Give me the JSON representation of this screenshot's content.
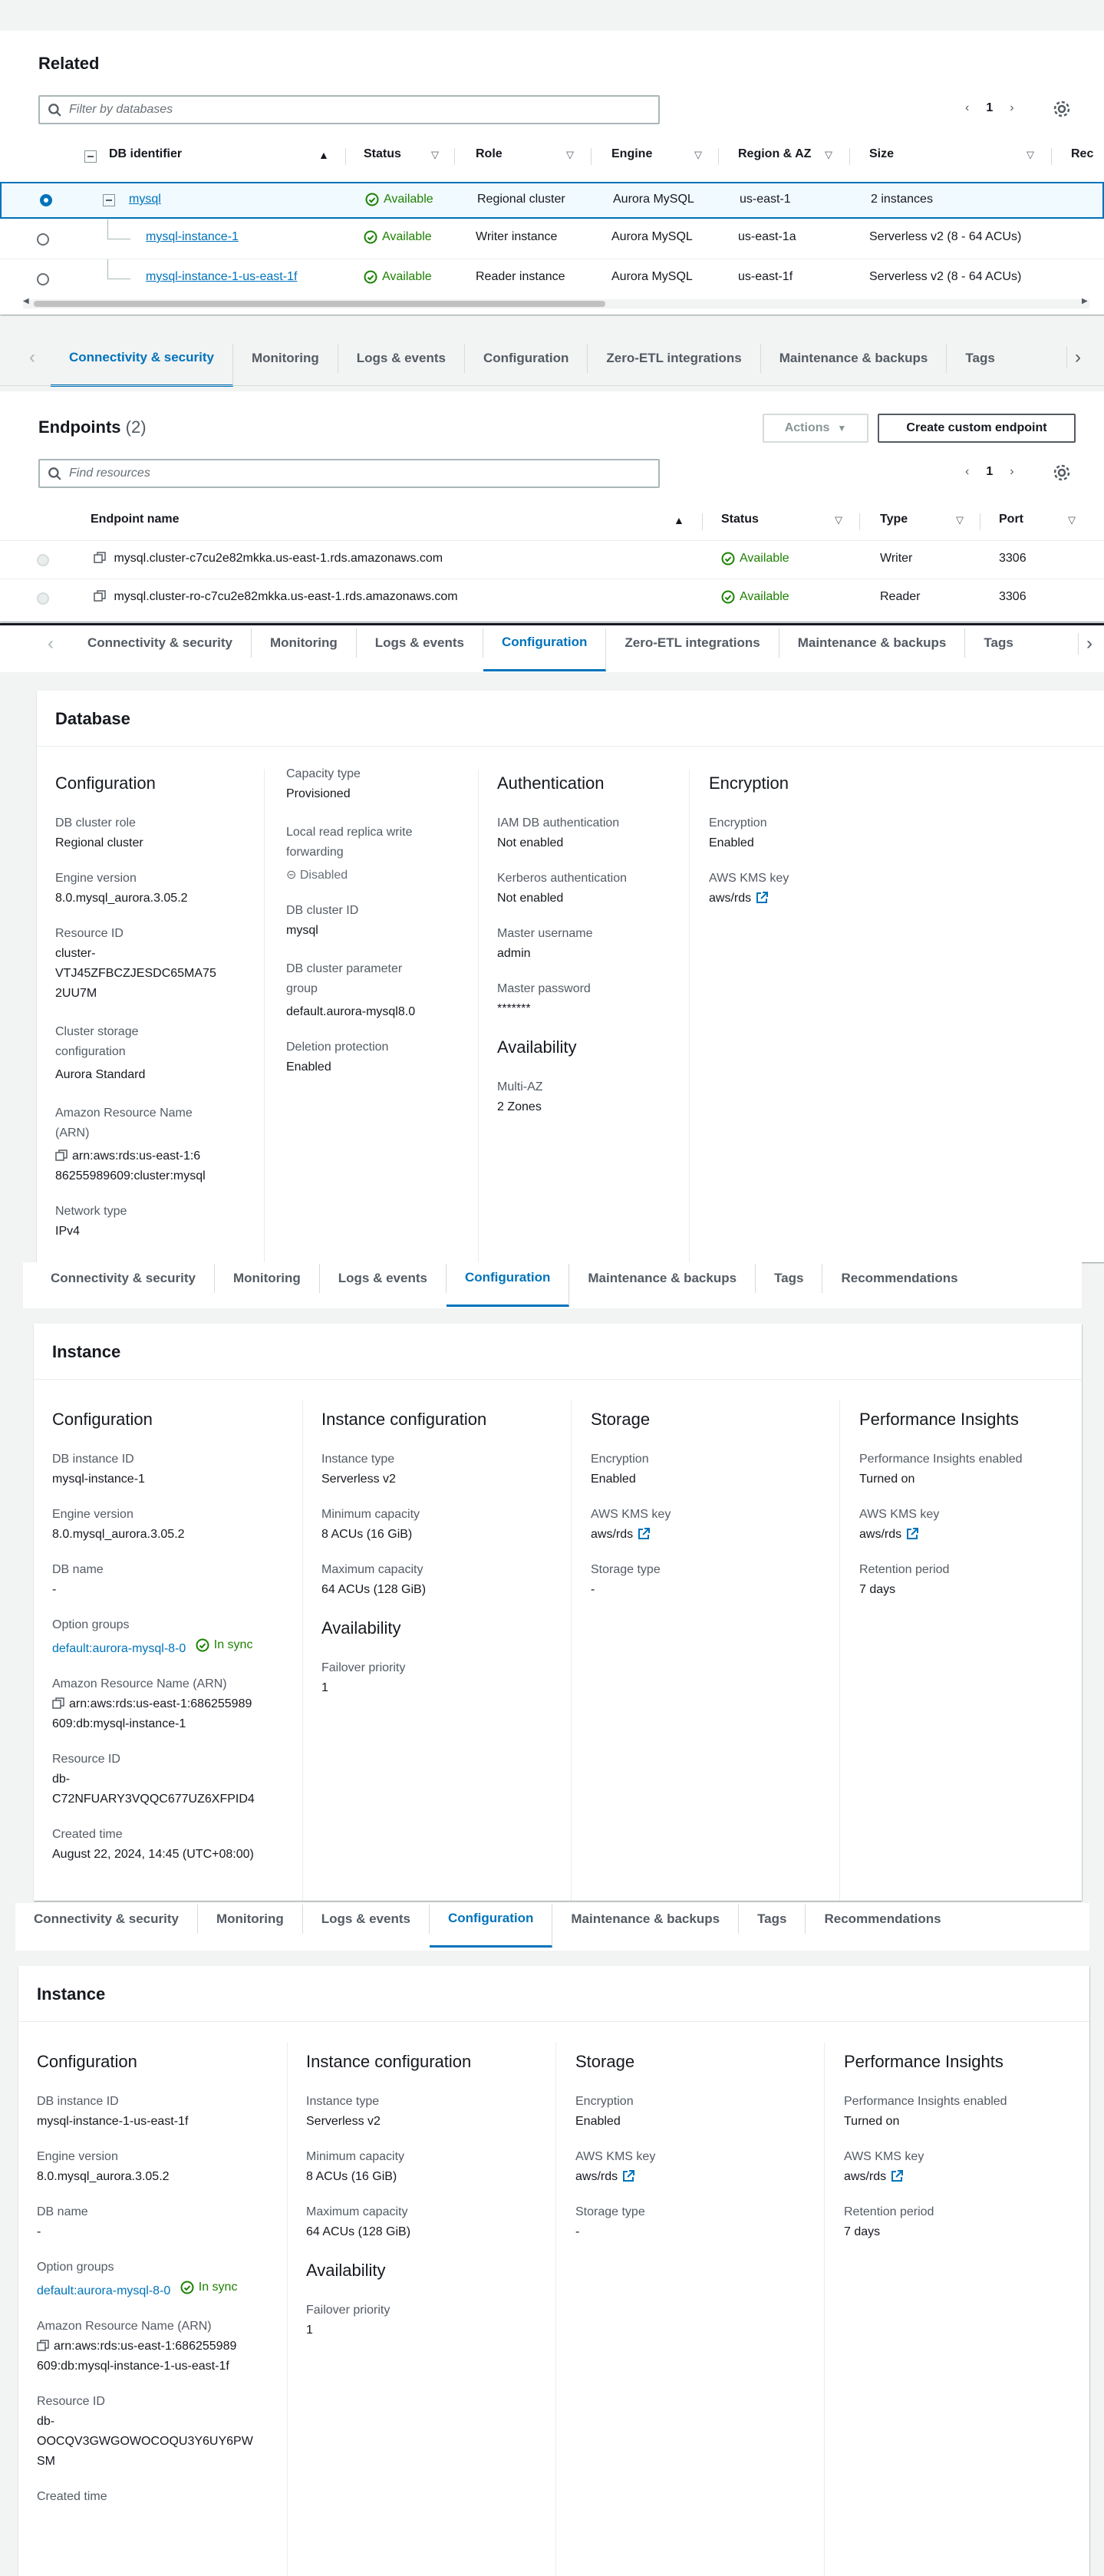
{
  "related": {
    "title": "Related",
    "filter_placeholder": "Filter by databases",
    "page": "1",
    "columns": [
      "DB identifier",
      "Status",
      "Role",
      "Engine",
      "Region & AZ",
      "Size",
      "Rec"
    ],
    "rows": [
      {
        "id": "mysql",
        "status": "Available",
        "role": "Regional cluster",
        "engine": "Aurora MySQL",
        "region": "us-east-1",
        "size": "2 instances"
      },
      {
        "id": "mysql-instance-1",
        "status": "Available",
        "role": "Writer instance",
        "engine": "Aurora MySQL",
        "region": "us-east-1a",
        "size": "Serverless v2 (8 - 64 ACUs)"
      },
      {
        "id": "mysql-instance-1-us-east-1f",
        "status": "Available",
        "role": "Reader instance",
        "engine": "Aurora MySQL",
        "region": "us-east-1f",
        "size": "Serverless v2 (8 - 64 ACUs)"
      }
    ]
  },
  "tabs1": [
    "Connectivity & security",
    "Monitoring",
    "Logs & events",
    "Configuration",
    "Zero-ETL integrations",
    "Maintenance & backups",
    "Tags"
  ],
  "endpoints": {
    "title": "Endpoints",
    "count": "(2)",
    "actions_label": "Actions",
    "create_label": "Create custom endpoint",
    "find_placeholder": "Find resources",
    "page": "1",
    "columns": [
      "Endpoint name",
      "Status",
      "Type",
      "Port"
    ],
    "rows": [
      {
        "name": "mysql.cluster-c7cu2e82mkka.us-east-1.rds.amazonaws.com",
        "status": "Available",
        "type": "Writer",
        "port": "3306"
      },
      {
        "name": "mysql.cluster-ro-c7cu2e82mkka.us-east-1.rds.amazonaws.com",
        "status": "Available",
        "type": "Reader",
        "port": "3306"
      }
    ]
  },
  "tabs2": [
    "Connectivity & security",
    "Monitoring",
    "Logs & events",
    "Configuration",
    "Zero-ETL integrations",
    "Maintenance & backups",
    "Tags"
  ],
  "database": {
    "title": "Database",
    "configuration_heading": "Configuration",
    "cluster_role_label": "DB cluster role",
    "cluster_role": "Regional cluster",
    "engine_version_label": "Engine version",
    "engine_version": "8.0.mysql_aurora.3.05.2",
    "resource_id_label": "Resource ID",
    "resource_id_1": "cluster-",
    "resource_id_2": "VTJ45ZFBCZJESDC65MA75",
    "resource_id_3": "2UU7M",
    "storage_config_label_1": "Cluster storage",
    "storage_config_label_2": "configuration",
    "storage_config": "Aurora Standard",
    "arn_label_1": "Amazon Resource Name",
    "arn_label_2": "(ARN)",
    "arn_1": "arn:aws:rds:us-east-1:6",
    "arn_2": "86255989609:cluster:mysql",
    "network_type_label": "Network type",
    "network_type": "IPv4",
    "capacity_type_label": "Capacity type",
    "capacity_type": "Provisioned",
    "local_read_label_1": "Local read replica write",
    "local_read_label_2": "forwarding",
    "local_read": "Disabled",
    "cluster_id_label": "DB cluster ID",
    "cluster_id": "mysql",
    "param_group_label_1": "DB cluster parameter",
    "param_group_label_2": "group",
    "param_group": "default.aurora-mysql8.0",
    "deletion_label": "Deletion protection",
    "deletion": "Enabled",
    "auth_heading": "Authentication",
    "iam_label": "IAM DB authentication",
    "iam": "Not enabled",
    "kerberos_label": "Kerberos authentication",
    "kerberos": "Not enabled",
    "master_user_label": "Master username",
    "master_user": "admin",
    "master_pw_label": "Master password",
    "master_pw": "*******",
    "availability_heading": "Availability",
    "multiaz_label": "Multi-AZ",
    "multiaz": "2 Zones",
    "encryption_heading": "Encryption",
    "encryption_label": "Encryption",
    "encryption": "Enabled",
    "kms_label": "AWS KMS key",
    "kms": "aws/rds"
  },
  "tabs3": [
    "Connectivity & security",
    "Monitoring",
    "Logs & events",
    "Configuration",
    "Maintenance & backups",
    "Tags",
    "Recommendations"
  ],
  "instance1": {
    "title": "Instance",
    "configuration_heading": "Configuration",
    "instance_id_label": "DB instance ID",
    "instance_id": "mysql-instance-1",
    "engine_version_label": "Engine version",
    "engine_version": "8.0.mysql_aurora.3.05.2",
    "db_name_label": "DB name",
    "db_name": "-",
    "option_groups_label": "Option groups",
    "option_group": "default:aurora-mysql-8-0",
    "option_status": "In sync",
    "arn_label": "Amazon Resource Name (ARN)",
    "arn_1": "arn:aws:rds:us-east-1:686255989",
    "arn_2": "609:db:mysql-instance-1",
    "resource_id_label": "Resource ID",
    "resource_id_1": "db-",
    "resource_id_2": "C72NFUARY3VQQC677UZ6XFPID4",
    "created_label": "Created time",
    "created": "August 22, 2024, 14:45 (UTC+08:00)",
    "instance_config_heading": "Instance configuration",
    "instance_type_label": "Instance type",
    "instance_type": "Serverless v2",
    "min_cap_label": "Minimum capacity",
    "min_cap": "8 ACUs (16 GiB)",
    "max_cap_label": "Maximum capacity",
    "max_cap": "64 ACUs (128 GiB)",
    "availability_heading": "Availability",
    "failover_label": "Failover priority",
    "failover": "1",
    "storage_heading": "Storage",
    "encryption_label": "Encryption",
    "encryption": "Enabled",
    "kms_label": "AWS KMS key",
    "kms": "aws/rds",
    "storage_type_label": "Storage type",
    "storage_type": "-",
    "pi_heading": "Performance Insights",
    "pi_enabled_label": "Performance Insights enabled",
    "pi_enabled": "Turned on",
    "pi_kms_label": "AWS KMS key",
    "pi_kms": "aws/rds",
    "retention_label": "Retention period",
    "retention": "7 days"
  },
  "tabs4": [
    "Connectivity & security",
    "Monitoring",
    "Logs & events",
    "Configuration",
    "Maintenance & backups",
    "Tags",
    "Recommendations"
  ],
  "instance2": {
    "title": "Instance",
    "configuration_heading": "Configuration",
    "instance_id_label": "DB instance ID",
    "instance_id": "mysql-instance-1-us-east-1f",
    "engine_version_label": "Engine version",
    "engine_version": "8.0.mysql_aurora.3.05.2",
    "db_name_label": "DB name",
    "db_name": "-",
    "option_groups_label": "Option groups",
    "option_group": "default:aurora-mysql-8-0",
    "option_status": "In sync",
    "arn_label": "Amazon Resource Name (ARN)",
    "arn_1": "arn:aws:rds:us-east-1:686255989",
    "arn_2": "609:db:mysql-instance-1-us-east-1f",
    "resource_id_label": "Resource ID",
    "resource_id_1": "db-",
    "resource_id_2": "OOCQV3GWGOWOCOQU3Y6UY6PW",
    "resource_id_3": "SM",
    "created_label": "Created time",
    "instance_config_heading": "Instance configuration",
    "instance_type_label": "Instance type",
    "instance_type": "Serverless v2",
    "min_cap_label": "Minimum capacity",
    "min_cap": "8 ACUs (16 GiB)",
    "max_cap_label": "Maximum capacity",
    "max_cap": "64 ACUs (128 GiB)",
    "availability_heading": "Availability",
    "failover_label": "Failover priority",
    "failover": "1",
    "storage_heading": "Storage",
    "encryption_label": "Encryption",
    "encryption": "Enabled",
    "kms_label": "AWS KMS key",
    "kms": "aws/rds",
    "storage_type_label": "Storage type",
    "storage_type": "-",
    "pi_heading": "Performance Insights",
    "pi_enabled_label": "Performance Insights enabled",
    "pi_enabled": "Turned on",
    "pi_kms_label": "AWS KMS key",
    "pi_kms": "aws/rds",
    "retention_label": "Retention period",
    "retention": "7 days"
  },
  "colors": {
    "link": "#0073bb",
    "success": "#1d8102",
    "border": "#d5dbdb"
  }
}
